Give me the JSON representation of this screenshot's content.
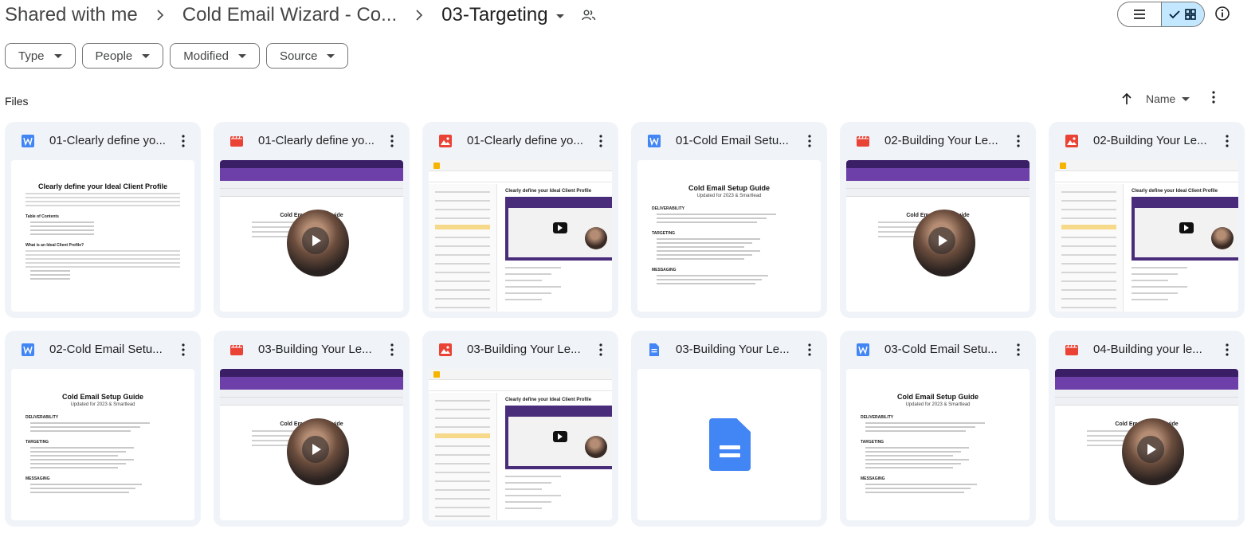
{
  "breadcrumb": {
    "items": [
      "Shared with me",
      "Cold Email Wizard - Co..."
    ],
    "current": "03-Targeting"
  },
  "toolbar": {
    "list_view_icon": "list-icon",
    "grid_view_icon": "grid-icon",
    "grid_view_active": true,
    "info_icon": "info-icon"
  },
  "filters": [
    {
      "label": "Type"
    },
    {
      "label": "People"
    },
    {
      "label": "Modified"
    },
    {
      "label": "Source"
    }
  ],
  "section": {
    "title": "Files",
    "sort_label": "Name"
  },
  "colors": {
    "word": "#4285f4",
    "video": "#ea4335",
    "image": "#ea4335",
    "gdoc": "#4285f4",
    "card_bg": "#f0f4f9",
    "toggle_active": "#c2e7ff"
  },
  "files": [
    {
      "title": "01-Clearly define yo...",
      "type": "word",
      "thumb": "doc-icp"
    },
    {
      "title": "01-Clearly define yo...",
      "type": "video",
      "thumb": "video"
    },
    {
      "title": "01-Clearly define yo...",
      "type": "image",
      "thumb": "screenshot"
    },
    {
      "title": "01-Cold Email Setu...",
      "type": "word",
      "thumb": "doc-guide"
    },
    {
      "title": "02-Building Your Le...",
      "type": "video",
      "thumb": "video"
    },
    {
      "title": "02-Building Your Le...",
      "type": "image",
      "thumb": "screenshot"
    },
    {
      "title": "02-Cold Email Setu...",
      "type": "word",
      "thumb": "doc-guide"
    },
    {
      "title": "03-Building Your Le...",
      "type": "video",
      "thumb": "video"
    },
    {
      "title": "03-Building Your Le...",
      "type": "image",
      "thumb": "screenshot"
    },
    {
      "title": "03-Building Your Le...",
      "type": "gdoc",
      "thumb": "gdoc"
    },
    {
      "title": "03-Cold Email Setu...",
      "type": "word",
      "thumb": "doc-guide"
    },
    {
      "title": "04-Building your le...",
      "type": "video",
      "thumb": "video"
    }
  ]
}
